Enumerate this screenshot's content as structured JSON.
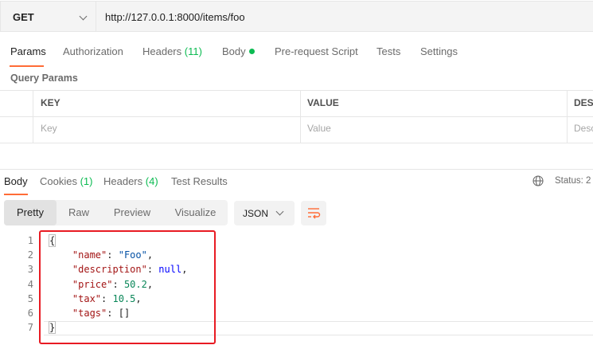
{
  "request": {
    "method": "GET",
    "url": "http://127.0.0.1:8000/items/foo",
    "tabs": {
      "params": "Params",
      "authorization": "Authorization",
      "headers": "Headers",
      "headers_count": "(11)",
      "body": "Body",
      "pre_request": "Pre-request Script",
      "tests": "Tests",
      "settings": "Settings"
    },
    "query_params_title": "Query Params",
    "table": {
      "col_key": "KEY",
      "col_value": "VALUE",
      "col_desc": "DES",
      "ph_key": "Key",
      "ph_value": "Value",
      "ph_desc": "Desc"
    }
  },
  "response": {
    "tabs": {
      "body": "Body",
      "cookies": "Cookies",
      "cookies_count": "(1)",
      "headers": "Headers",
      "headers_count": "(4)",
      "test_results": "Test Results"
    },
    "status": "Status: 2",
    "views": [
      "Pretty",
      "Raw",
      "Preview",
      "Visualize"
    ],
    "format": "JSON",
    "code_lines": [
      {
        "n": "1",
        "text": "{"
      },
      {
        "n": "2",
        "key": "\"name\"",
        "val": "\"Foo\"",
        "vtype": "str"
      },
      {
        "n": "3",
        "key": "\"description\"",
        "val": "null",
        "vtype": "kw"
      },
      {
        "n": "4",
        "key": "\"price\"",
        "val": "50.2",
        "vtype": "num"
      },
      {
        "n": "5",
        "key": "\"tax\"",
        "val": "10.5",
        "vtype": "num"
      },
      {
        "n": "6",
        "key": "\"tags\"",
        "val": "[]",
        "vtype": "plain",
        "last": true
      },
      {
        "n": "7",
        "text": "}"
      }
    ]
  },
  "colors": {
    "accent": "#ff6c37",
    "count_green": "#0cbb52",
    "highlight_red": "#e81b23"
  }
}
